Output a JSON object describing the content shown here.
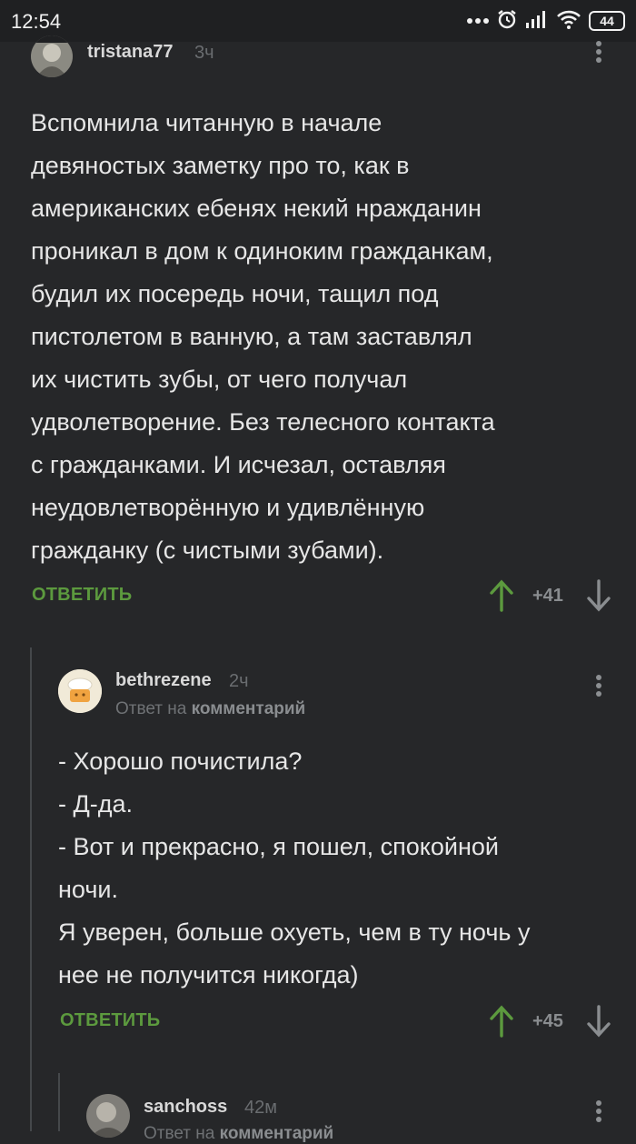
{
  "status": {
    "time": "12:54",
    "battery": "44"
  },
  "comments": [
    {
      "username": "tristana77",
      "time": "3ч",
      "lines": [
        "Вспомнила читанную в начале",
        "девяностых заметку про то, как в",
        "американских ебенях некий нражданин",
        "проникал в дом к одиноким гражданкам,",
        "будил их посередь ночи, тащил под",
        "пистолетом в ванную, а там заставлял",
        "их чистить зубы, от чего получал",
        "удволетворение. Без телесного контакта",
        "с гражданками. И исчезал, оставляя",
        "неудовлетворённую и удивлённую",
        "гражданку (с чистыми зубами)."
      ],
      "reply_label": "ОТВЕТИТЬ",
      "score": "+41"
    },
    {
      "username": "bethrezene",
      "time": "2ч",
      "reply_prefix": "Ответ на",
      "reply_target": "комментарий",
      "lines": [
        "- Хорошо почистила?",
        "- Д-да.",
        "- Вот и прекрасно, я пошел, спокойной",
        "ночи.",
        "Я уверен, больше охуеть, чем в ту ночь у",
        "нее не получится никогда)"
      ],
      "reply_label": "ОТВЕТИТЬ",
      "score": "+45"
    },
    {
      "username": "sanchoss",
      "time": "42м",
      "reply_prefix": "Ответ на",
      "reply_target": "комментарий"
    }
  ],
  "colors": {
    "background": "#262729",
    "accent_green": "#5c9a3e",
    "muted": "#6a6d70"
  }
}
